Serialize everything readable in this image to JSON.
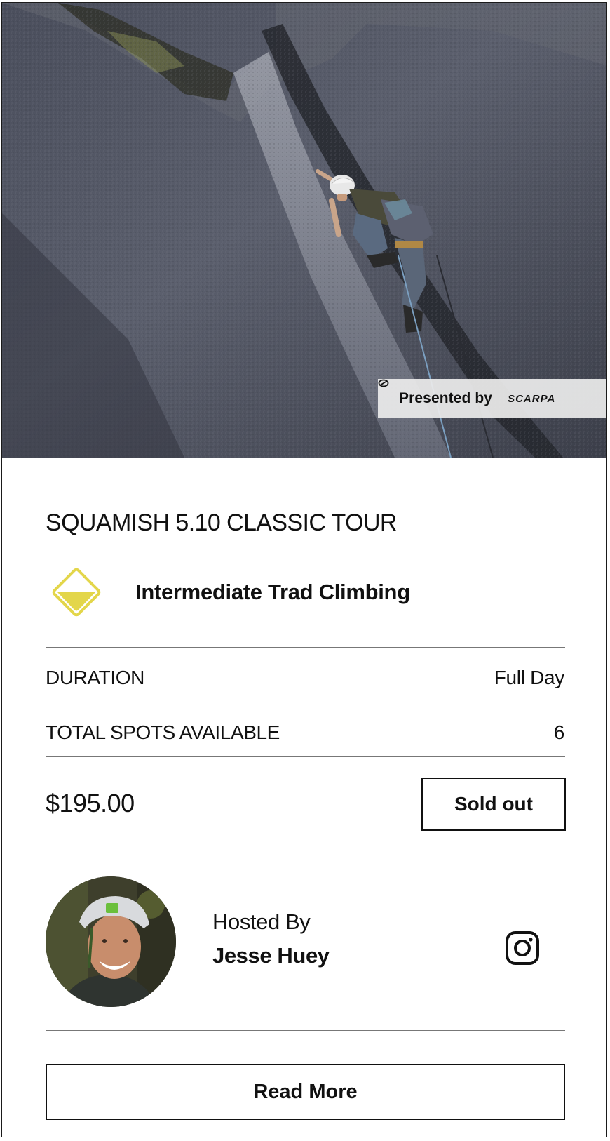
{
  "hero": {
    "image": "rock-climber-on-granite-crack",
    "sponsor_label": "Presented by",
    "sponsor_logo": "SCARPA"
  },
  "tour": {
    "title": "SQUAMISH 5.10 CLASSIC TOUR",
    "level_icon": "intermediate-diamond-icon",
    "level_color": "#e3d64a",
    "level": "Intermediate Trad Climbing"
  },
  "details": [
    {
      "label": "DURATION",
      "value": "Full Day"
    },
    {
      "label": "TOTAL SPOTS AVAILABLE",
      "value": "6"
    }
  ],
  "pricing": {
    "price": "$195.00",
    "status_button": "Sold out"
  },
  "host": {
    "hosted_by_label": "Hosted By",
    "name": "Jesse Huey",
    "social_icon": "instagram-icon"
  },
  "actions": {
    "read_more": "Read More"
  }
}
